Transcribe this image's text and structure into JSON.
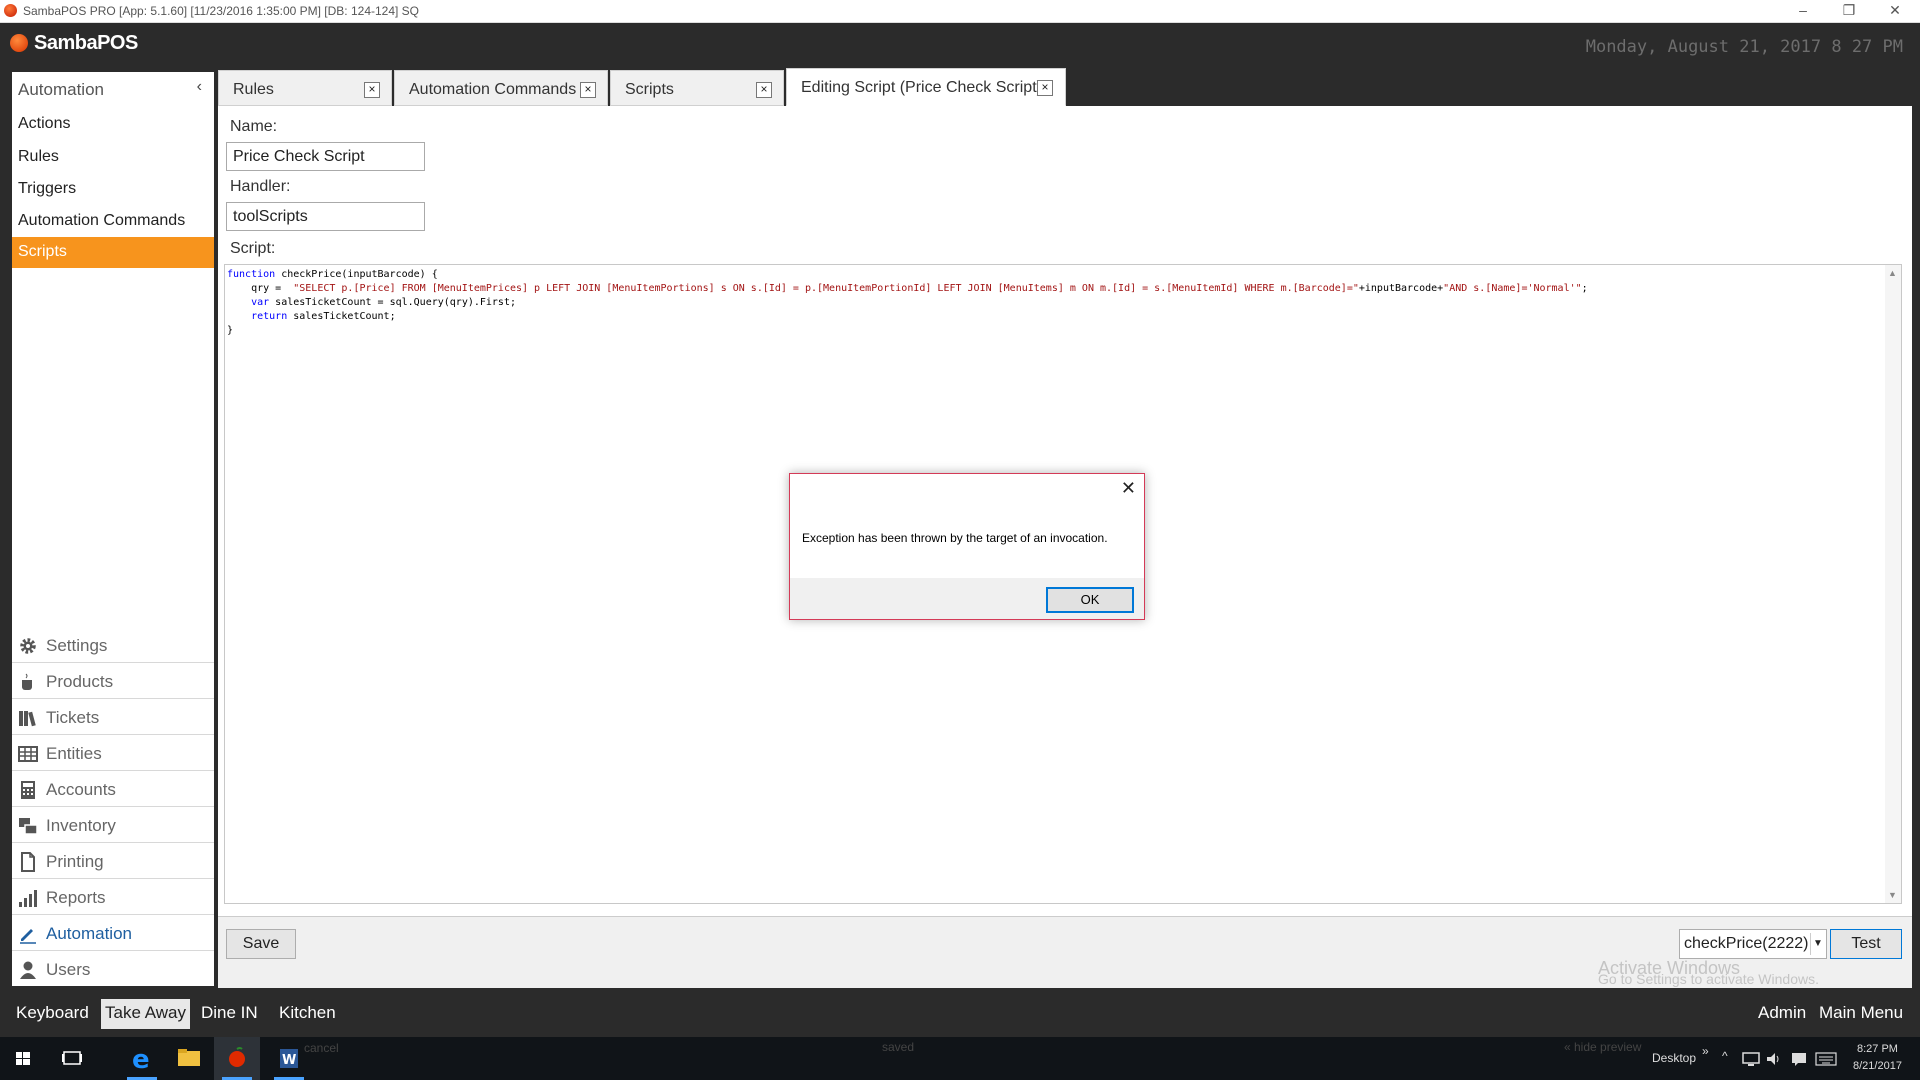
{
  "window": {
    "title": "SambaPOS PRO [App: 5.1.60] [11/23/2016 1:35:00 PM] [DB: 124-124] SQ",
    "minimize_glyph": "–",
    "restore_glyph": "❐",
    "close_glyph": "✕"
  },
  "header": {
    "logo_text": "SambaPOS",
    "clock": "Monday, August 21, 2017 8 27 PM"
  },
  "sidebar": {
    "header_label": "Automation",
    "collapse_glyph": "‹",
    "items": [
      {
        "label": "Actions"
      },
      {
        "label": "Rules"
      },
      {
        "label": "Triggers"
      },
      {
        "label": "Automation Commands"
      },
      {
        "label": "Scripts"
      }
    ],
    "bottom_items": [
      {
        "label": "Settings",
        "icon": "gear-icon"
      },
      {
        "label": "Products",
        "icon": "coffee-cup-icon"
      },
      {
        "label": "Tickets",
        "icon": "books-icon"
      },
      {
        "label": "Entities",
        "icon": "table-icon"
      },
      {
        "label": "Accounts",
        "icon": "calculator-icon"
      },
      {
        "label": "Inventory",
        "icon": "boxes-icon"
      },
      {
        "label": "Printing",
        "icon": "document-icon"
      },
      {
        "label": "Reports",
        "icon": "bar-chart-icon"
      },
      {
        "label": "Automation",
        "icon": "pencil-icon"
      },
      {
        "label": "Users",
        "icon": "user-icon"
      }
    ]
  },
  "tabs": [
    {
      "label": "Rules"
    },
    {
      "label": "Automation Commands"
    },
    {
      "label": "Scripts"
    },
    {
      "label": "Editing Script (Price Check Script)"
    }
  ],
  "tab_close_glyph": "×",
  "form": {
    "name_label": "Name:",
    "name_value": "Price Check Script",
    "handler_label": "Handler:",
    "handler_value": "toolScripts",
    "script_label": "Script:"
  },
  "script": {
    "line1_kw": "function",
    "line1_rest": " checkPrice(inputBarcode) {",
    "line2_pre": "    qry =  ",
    "line2_str1": "\"SELECT p.[Price] FROM [MenuItemPrices] p LEFT JOIN [MenuItemPortions] s ON s.[Id] = p.[MenuItemPortionId] LEFT JOIN [MenuItems] m ON m.[Id] = s.[MenuItemId] WHERE m.[Barcode]=\"",
    "line2_mid": "+inputBarcode+",
    "line2_str2": "\"AND s.[Name]='Normal'\"",
    "line2_end": ";",
    "line3_pre": "    ",
    "line3_kw": "var",
    "line3_rest": " salesTicketCount = sql.Query(qry).First;",
    "line4_pre": "    ",
    "line4_kw": "return",
    "line4_rest": " salesTicketCount;",
    "line5": "}"
  },
  "bottom": {
    "save_label": "Save",
    "select_value": "checkPrice(2222)",
    "test_label": "Test",
    "activate_title": "Activate Windows",
    "activate_sub": "Go to Settings to activate Windows."
  },
  "appbar": {
    "left": [
      "Keyboard",
      "Take Away",
      "Dine IN",
      "Kitchen"
    ],
    "right": [
      "Admin",
      "Main Menu"
    ]
  },
  "taskbar": {
    "faded_left": "cancel",
    "faded_mid": "saved",
    "faded_right": "« hide preview",
    "desktop_label": "Desktop",
    "time": "8:27 PM",
    "date": "8/21/2017"
  },
  "dialog": {
    "close_glyph": "✕",
    "message": "Exception has been thrown by the target of an invocation.",
    "ok_label": "OK"
  },
  "colors": {
    "accent_orange": "#f7941d",
    "frame_dark": "#2b2b2b",
    "dialog_border": "#d43a57",
    "focus_blue": "#0078d7"
  }
}
